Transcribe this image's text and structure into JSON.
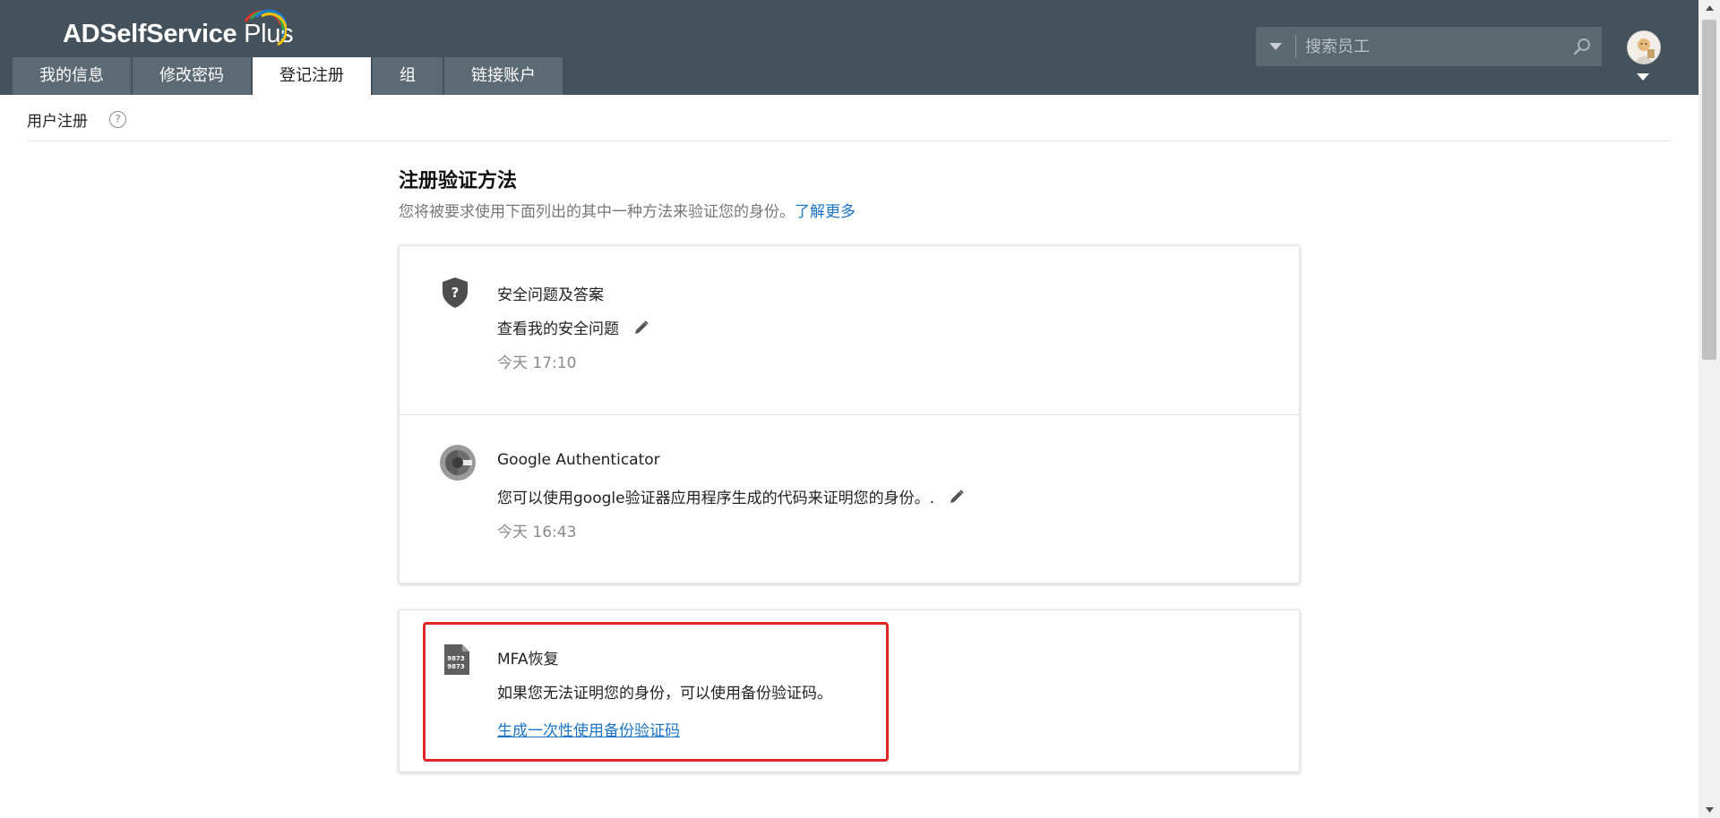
{
  "app": {
    "logo_main": "ADSelfService",
    "logo_plus": "Plus"
  },
  "tabs": [
    {
      "label": "我的信息",
      "active": false
    },
    {
      "label": "修改密码",
      "active": false
    },
    {
      "label": "登记注册",
      "active": true
    },
    {
      "label": "组",
      "active": false
    },
    {
      "label": "链接账户",
      "active": false
    }
  ],
  "search": {
    "placeholder": "搜索员工",
    "value": ""
  },
  "subheader": {
    "title": "用户注册",
    "help": "?"
  },
  "main": {
    "title": "注册验证方法",
    "description": "您将被要求使用下面列出的其中一种方法来验证您的身份。",
    "learn_more": "了解更多"
  },
  "methods": [
    {
      "icon": "shield-question-icon",
      "title": "安全问题及答案",
      "description": "查看我的安全问题",
      "time": "今天 17:10"
    },
    {
      "icon": "google-authenticator-icon",
      "title": "Google Authenticator",
      "description": "您可以使用google验证器应用程序生成的代码来证明您的身份。.",
      "time": "今天 16:43"
    }
  ],
  "recovery": {
    "icon": "backup-code-file-icon",
    "icon_text_1": "9873",
    "icon_text_2": "9873",
    "title": "MFA恢复",
    "description": "如果您无法证明您的身份，可以使用备份验证码。",
    "link": "生成一次性使用备份验证码"
  },
  "colors": {
    "header_bg": "#45525b",
    "tab_bg": "#5c6a73",
    "link": "#1a73c4",
    "highlight": "#e02424"
  }
}
